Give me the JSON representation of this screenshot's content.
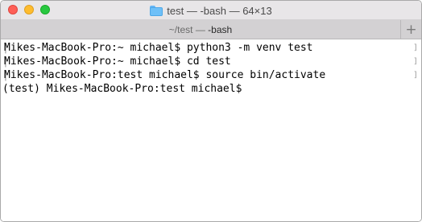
{
  "window": {
    "title": "test — -bash — 64×13",
    "tab_label_prefix": "~/test — ",
    "tab_label_bold": "-bash",
    "new_tab_glyph": "+"
  },
  "terminal": {
    "lines": [
      "Mikes-MacBook-Pro:~ michael$ python3 -m venv test",
      "Mikes-MacBook-Pro:~ michael$ cd test",
      "Mikes-MacBook-Pro:test michael$ source bin/activate",
      "(test) Mikes-MacBook-Pro:test michael$"
    ]
  },
  "colors": {
    "close": "#fe5f57",
    "minimize": "#febc2e",
    "zoom": "#28c840",
    "folder": "#6ec0f8"
  }
}
